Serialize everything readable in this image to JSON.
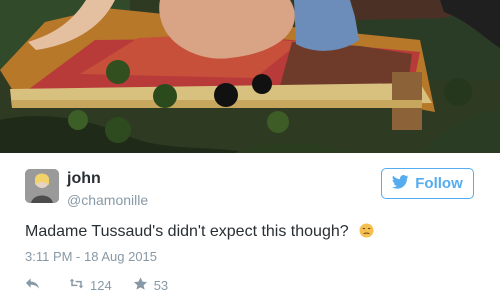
{
  "tweet": {
    "name": "john",
    "handle": "@chamonille",
    "follow_label": "Follow",
    "text": "Madame Tussaud's didn't expect this though?",
    "timestamp": "3:11 PM - 18 Aug 2015",
    "retweets": "124",
    "favorites": "53"
  },
  "icons": {
    "avatar": "avatar",
    "follow": "twitter-bird-icon",
    "emoji": "unamused-face-emoji",
    "reply": "reply-icon",
    "retweet": "retweet-icon",
    "favorite": "star-icon"
  },
  "colors": {
    "accent": "#55acee",
    "text": "#292f33",
    "muted": "#8899a6"
  }
}
